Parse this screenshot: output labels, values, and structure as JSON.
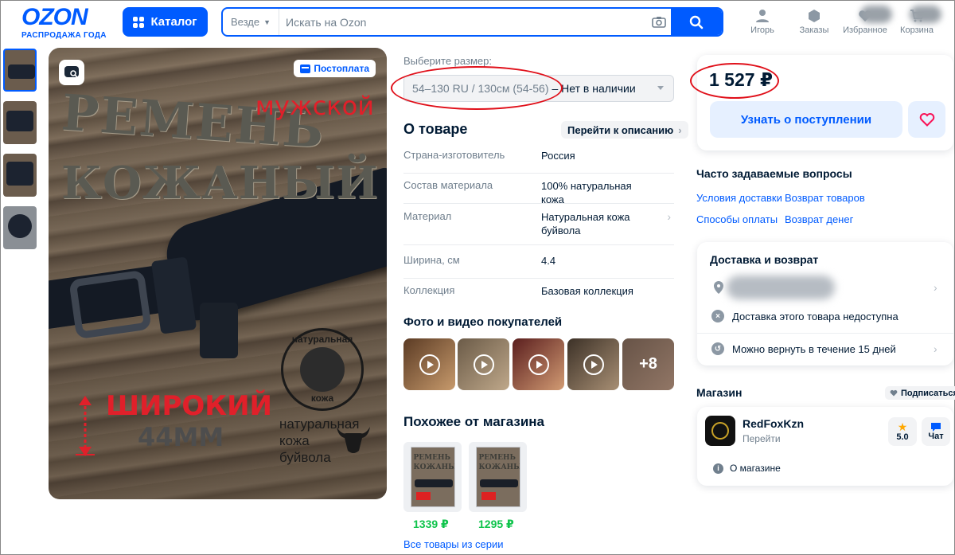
{
  "header": {
    "logo": "OZON",
    "logo_sub": "РАСПРОДАЖА ГОДА",
    "catalog": "Каталог",
    "search_scope": "Везде",
    "search_placeholder": "Искать на Ozon",
    "nav": [
      "Игорь",
      "Заказы",
      "Избранное",
      "Корзина"
    ]
  },
  "gallery": {
    "badge": "Постоплата",
    "image_text": {
      "title1": "РЕМЕНЬ",
      "title2": "КОЖАНЫЙ",
      "men": "мужской",
      "wide": "ШИРОКИЙ",
      "mm": "44ММ",
      "seal_top": "натуральная",
      "seal_bottom": "кожа",
      "natural": "натуральная",
      "leather": "кожа",
      "buffalo": "буйвола"
    }
  },
  "size": {
    "label": "Выберите размер:",
    "value": "54–130 RU / 130см (54-56)",
    "status": "– Нет в наличии"
  },
  "about": {
    "title": "О товаре",
    "to_description": "Перейти к описанию",
    "specs": [
      {
        "k": "Страна-изготовитель",
        "v": "Россия"
      },
      {
        "k": "Состав материала",
        "v": "100% натуральная кожа"
      },
      {
        "k": "Материал",
        "v": "Натуральная кожа буйвола"
      },
      {
        "k": "Ширина, см",
        "v": "4.4"
      },
      {
        "k": "Коллекция",
        "v": "Базовая коллекция"
      }
    ]
  },
  "photos": {
    "title": "Фото и видео покупателей",
    "more": "+8"
  },
  "similar": {
    "title": "Похожее от магазина",
    "items": [
      {
        "price": "1339 ₽",
        "card1": "РЕМЕНЬ",
        "card2": "КОЖАНЫЙ"
      },
      {
        "price": "1295 ₽",
        "card1": "РЕМЕНЬ",
        "card2": "КОЖАНЫЙ"
      }
    ],
    "all_series": "Все товары из серии"
  },
  "buy": {
    "price": "1 527 ₽",
    "notify": "Узнать о поступлении"
  },
  "faq": {
    "title": "Часто задаваемые вопросы",
    "links": [
      "Условия доставки",
      "Возврат товаров",
      "Способы оплаты",
      "Возврат денег"
    ]
  },
  "delivery": {
    "title": "Доставка и возврат",
    "unavailable": "Доставка этого товара недоступна",
    "return": "Можно вернуть в течение 15 дней"
  },
  "shop": {
    "title": "Магазин",
    "subscribe": "Подписаться",
    "name": "RedFoxKzn",
    "go": "Перейти",
    "rating": "5.0",
    "chat": "Чат",
    "about": "О магазине"
  },
  "colors": {
    "brand": "#005bff",
    "price_green": "#10c44c",
    "annotation_red": "#e0101a"
  }
}
